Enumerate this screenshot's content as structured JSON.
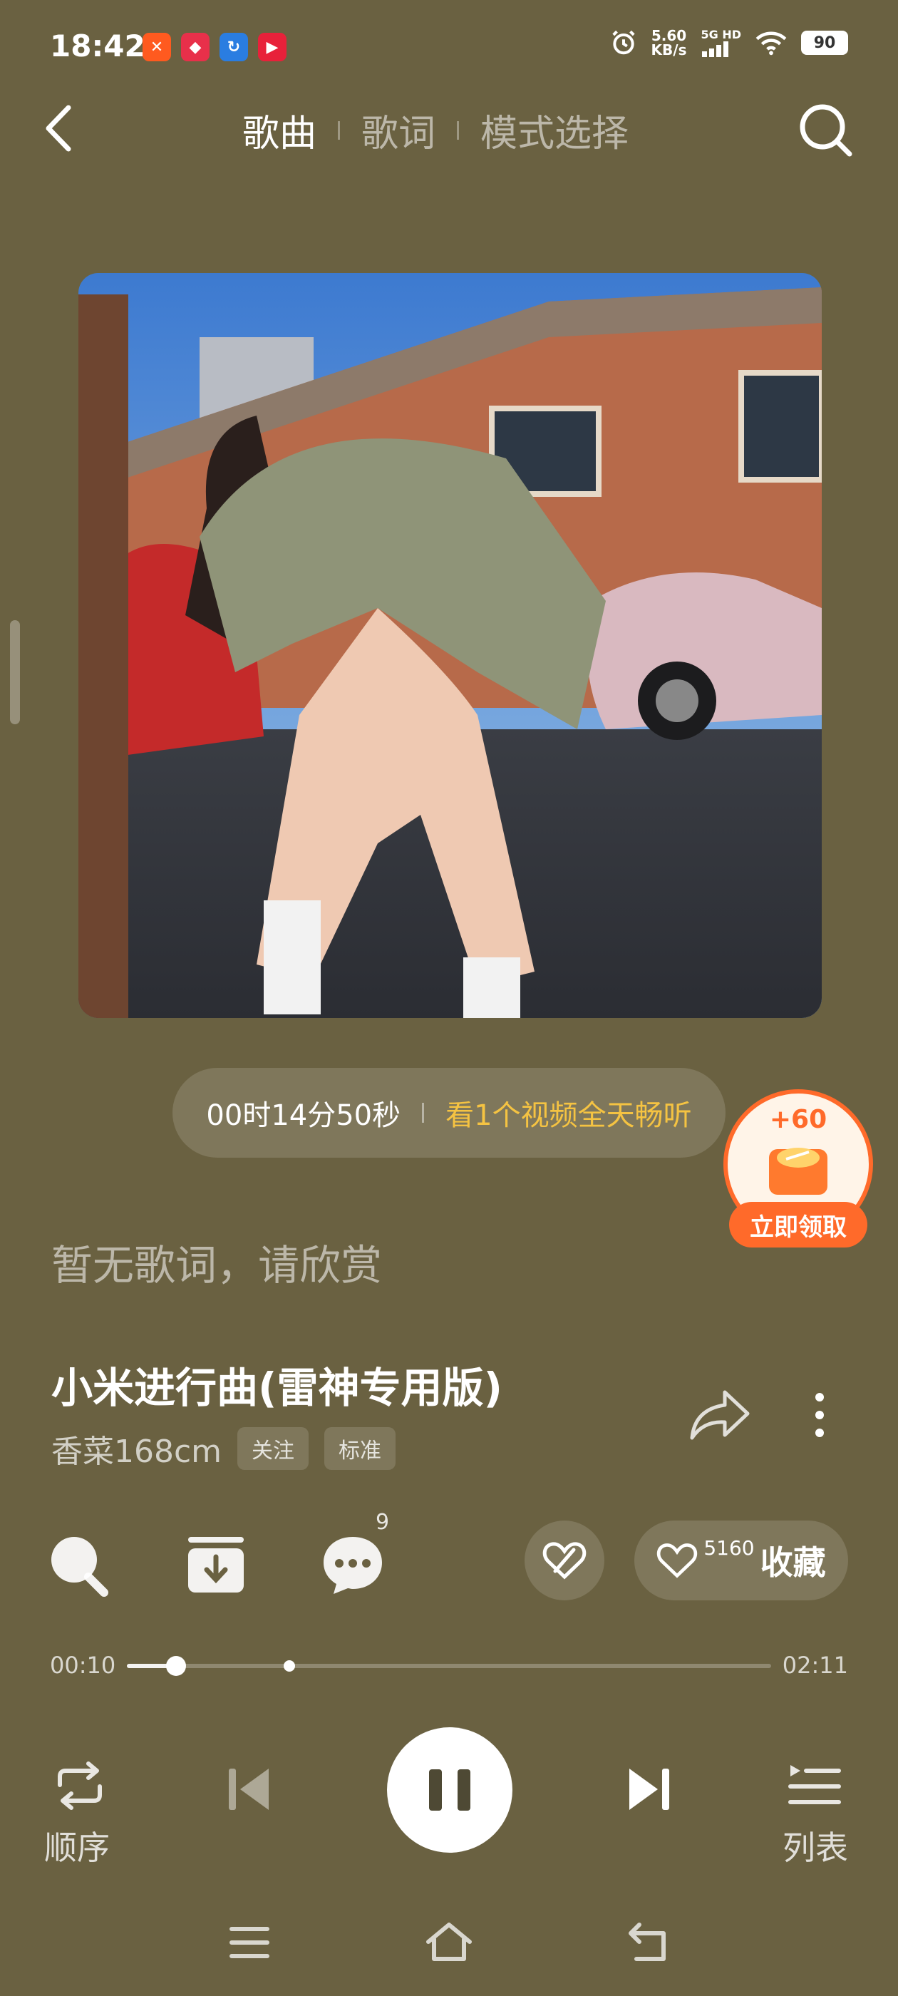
{
  "status_bar": {
    "time": "18:42",
    "net_speed_value": "5.60",
    "net_speed_unit": "KB/s",
    "network": "5G HD",
    "battery": "90",
    "icons": [
      "alarm-icon",
      "signal-icon",
      "wifi-icon",
      "battery-icon"
    ]
  },
  "header": {
    "tabs": [
      {
        "label": "歌曲",
        "active": true
      },
      {
        "label": "歌词",
        "active": false
      },
      {
        "label": "模式选择",
        "active": false
      }
    ]
  },
  "timer": {
    "remaining": "00时14分50秒",
    "cta": "看1个视频全天畅听"
  },
  "reward": {
    "points": "+60",
    "button": "立即领取"
  },
  "lyrics": {
    "empty_text": "暂无歌词，请欣赏"
  },
  "song": {
    "title": "小米进行曲(雷神专用版)",
    "artist": "香菜168cm",
    "follow_label": "关注",
    "quality_label": "标准"
  },
  "actions": {
    "comment_count": "9",
    "favorite_count": "5160",
    "favorite_label": "收藏"
  },
  "progress": {
    "current": "00:10",
    "total": "02:11",
    "fraction": 0.076
  },
  "controls": {
    "mode_label": "顺序",
    "list_label": "列表"
  },
  "colors": {
    "background": "#6a6141",
    "accent": "#f5c342",
    "reward": "#ff6a2a"
  }
}
